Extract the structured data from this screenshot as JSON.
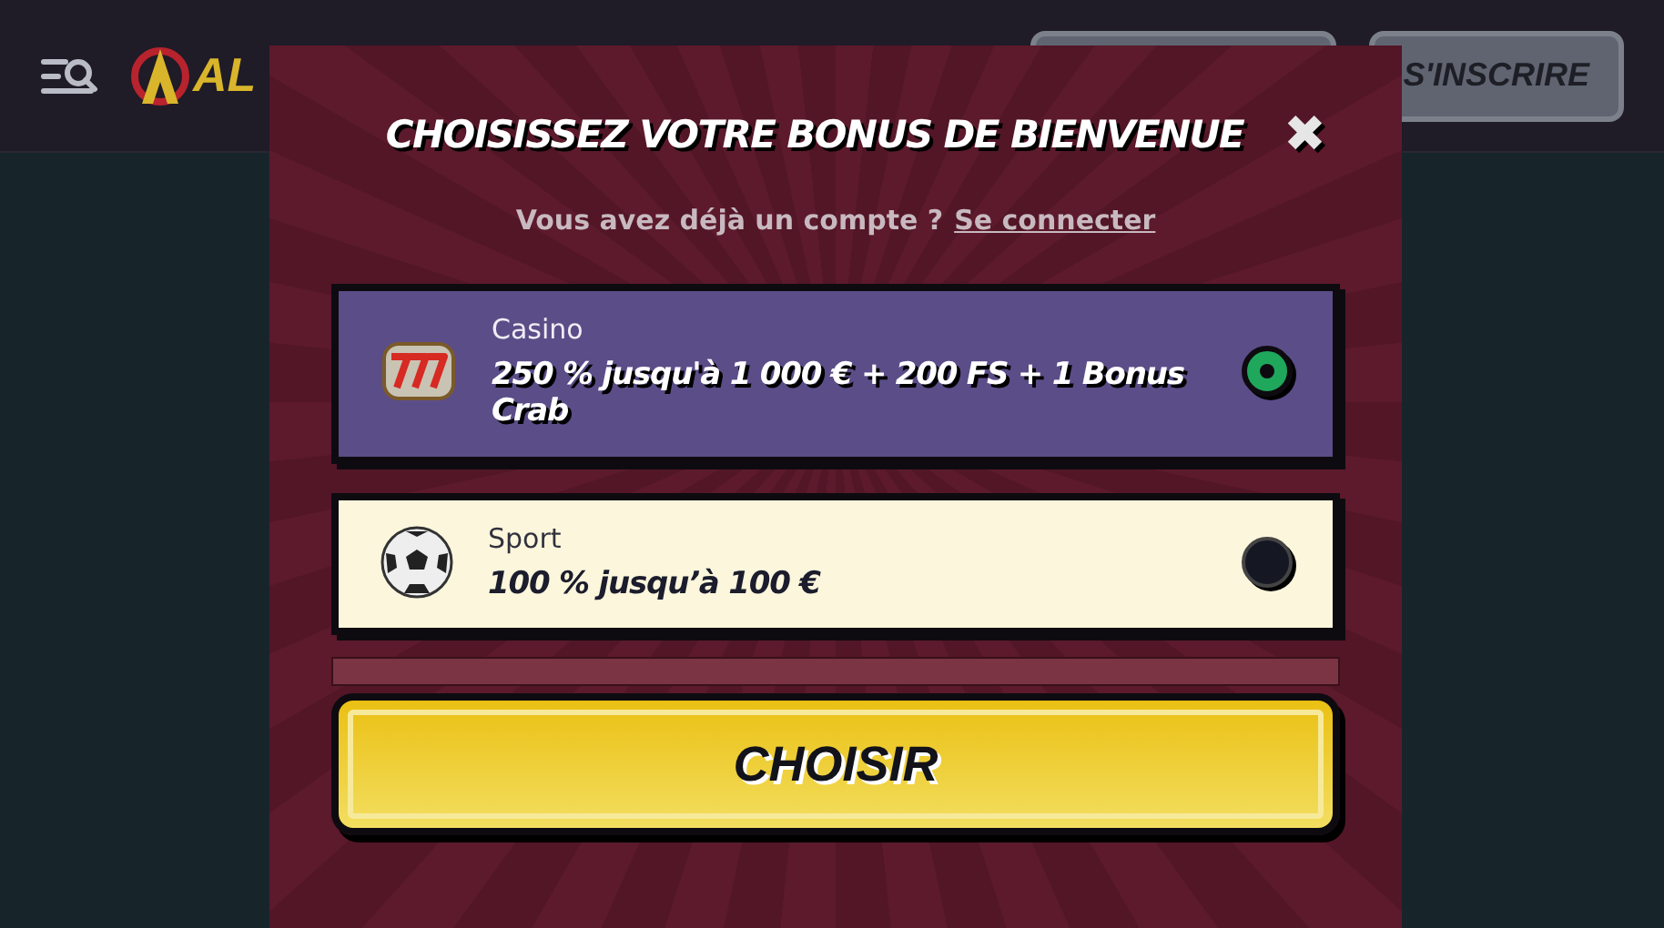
{
  "header": {
    "logo": "AL",
    "signup_button": "S'INSCRIRE"
  },
  "modal": {
    "title": "CHOISISSEZ VOTRE BONUS DE BIENVENUE",
    "close": "✖",
    "account_prompt": "Vous avez déjà un compte ?",
    "login_link": "Se connecter",
    "options": [
      {
        "kind": "casino",
        "name": "Casino",
        "offer": "250 % jusqu'à 1 000 € + 200 FS + 1 Bonus Crab",
        "selected": true
      },
      {
        "kind": "sport",
        "name": "Sport",
        "offer": "100 % jusqu’à 100 €",
        "selected": false
      }
    ],
    "choose_button": "CHOISIR"
  }
}
